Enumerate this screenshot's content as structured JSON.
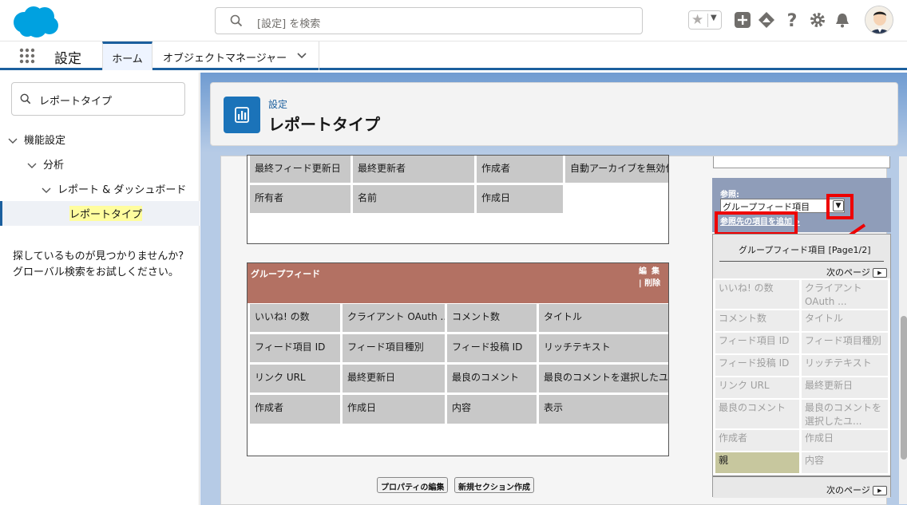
{
  "header": {
    "search_placeholder": "[設定] を検索",
    "icons": [
      "salesforce-logo",
      "search-icon",
      "star-icon",
      "chevron-down-icon",
      "add-icon",
      "trailhead-icon",
      "help-icon",
      "gear-icon",
      "bell-icon",
      "avatar"
    ]
  },
  "nav": {
    "app_name": "設定",
    "tabs": [
      {
        "label": "ホーム"
      },
      {
        "label": "オブジェクトマネージャー"
      }
    ]
  },
  "sidebar": {
    "quickfind_value": "レポートタイプ",
    "tree": [
      {
        "label": "機能設定"
      },
      {
        "label": "分析"
      },
      {
        "label": "レポート & ダッシュボード"
      },
      {
        "label": "レポートタイプ"
      }
    ],
    "help_line1": "探しているものが見つかりませんか?",
    "help_line2": "グローバル検索をお試しください。"
  },
  "page_header": {
    "breadcrumb": "設定",
    "title": "レポートタイプ"
  },
  "section1": {
    "rows": [
      [
        "最終フィード更新日",
        "最終更新者",
        "作成者",
        "自動アーカイブを無効化"
      ],
      [
        "所有者",
        "名前",
        "作成日",
        ""
      ]
    ]
  },
  "section2": {
    "title": "グループフィード",
    "edit": "編集",
    "delete": "削除",
    "rows": [
      [
        "いいね! の数",
        "クライアント OAuth ...",
        "コメント数",
        "タイトル"
      ],
      [
        "フィード項目 ID",
        "フィード項目種別",
        "フィード投稿 ID",
        "リッチテキスト"
      ],
      [
        "リンク URL",
        "最終更新日",
        "最良のコメント",
        "最良のコメントを選択したユ..."
      ],
      [
        "作成者",
        "作成日",
        "内容",
        "表示"
      ]
    ]
  },
  "buttons": {
    "edit_properties": "プロパティの編集",
    "new_section": "新規セクション作成"
  },
  "right_panel": {
    "ref_label": "参照:",
    "ref_select": "グループフィード項目",
    "add_ref_link": "参照先の項目を追加 »",
    "list_title": "グループフィード項目 [Page1/2]",
    "next_page": "次のページ",
    "fields": [
      [
        "いいね! の数",
        "クライアント OAuth ..."
      ],
      [
        "コメント数",
        "タイトル"
      ],
      [
        "フィード項目 ID",
        "フィード項目種別"
      ],
      [
        "フィード投稿 ID",
        "リッチテキスト"
      ],
      [
        "リンク URL",
        "最終更新日"
      ],
      [
        "最良のコメント",
        "最良のコメントを選択したユ..."
      ],
      [
        "作成者",
        "作成日"
      ],
      [
        "親",
        "内容"
      ]
    ]
  },
  "colors": {
    "brand": "#00a1e0",
    "nav_accent": "#1b5f9e",
    "section_header": "#b37163",
    "highlight_box": "#ee0000"
  }
}
